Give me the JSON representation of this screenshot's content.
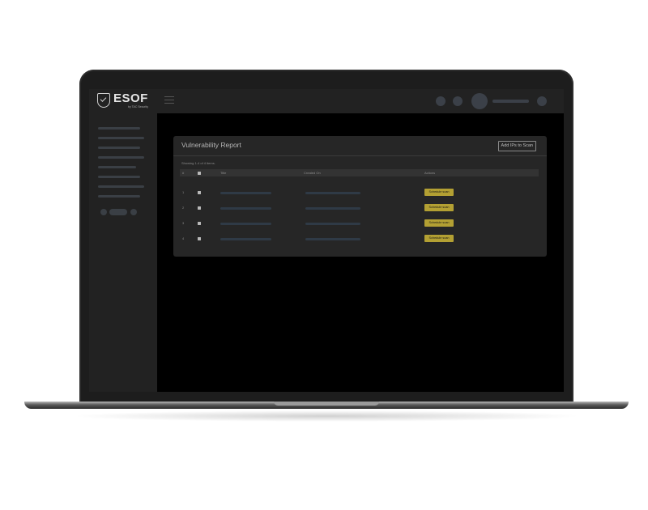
{
  "app": {
    "brand_name": "ESOF",
    "brand_sub": "by TAC Security"
  },
  "report": {
    "title": "Vulnerability Report",
    "add_button_label": "Add IPs to Scan",
    "showing_text": "Showing 1-4 of 4 items.",
    "columns": {
      "num": "#",
      "title": "Title",
      "created_on": "Created On",
      "actions": "Actions"
    },
    "rows": [
      {
        "num": "1",
        "action_label": "Schedule scan"
      },
      {
        "num": "2",
        "action_label": "Schedule scan"
      },
      {
        "num": "3",
        "action_label": "Schedule scan"
      },
      {
        "num": "4",
        "action_label": "Schedule scan"
      }
    ]
  },
  "colors": {
    "accent_button": "#b3a033",
    "panel": "#262626",
    "chrome": "#222222",
    "background": "#000000"
  }
}
